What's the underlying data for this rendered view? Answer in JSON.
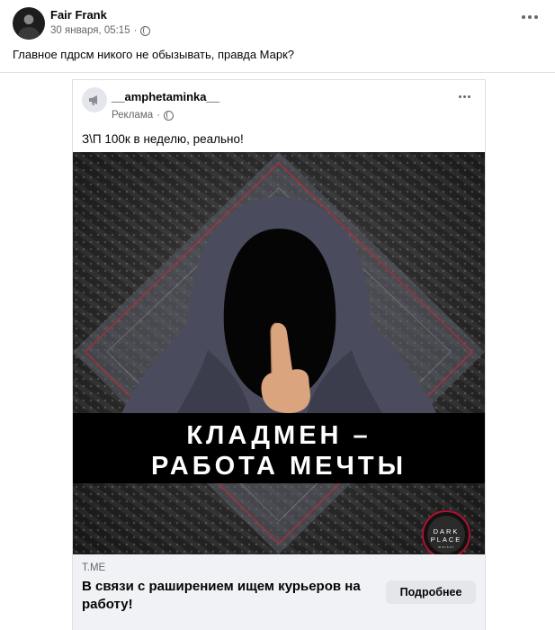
{
  "post": {
    "author": "Fair Frank",
    "date": "30 января, 05:15",
    "text": "Главное пдрсм никого не обызывать, правда Марк?"
  },
  "shared_ad": {
    "author": "__amphetaminka__",
    "label": "Реклама",
    "text": "З\\П 100к в неделю, реально!",
    "image": {
      "banner_line1": "КЛАДМЕН –",
      "banner_line2": "РАБОТА МЕЧТЫ",
      "logo_line1": "DARK",
      "logo_line2": "PLACE",
      "logo_line3": "market"
    },
    "link": {
      "domain": "T.ME",
      "headline": "В связи с раширением ищем курьеров на работу!",
      "cta": "Подробнее"
    }
  },
  "icons": [
    "avatar",
    "globe-icon",
    "more-icon",
    "megaphone-icon"
  ]
}
